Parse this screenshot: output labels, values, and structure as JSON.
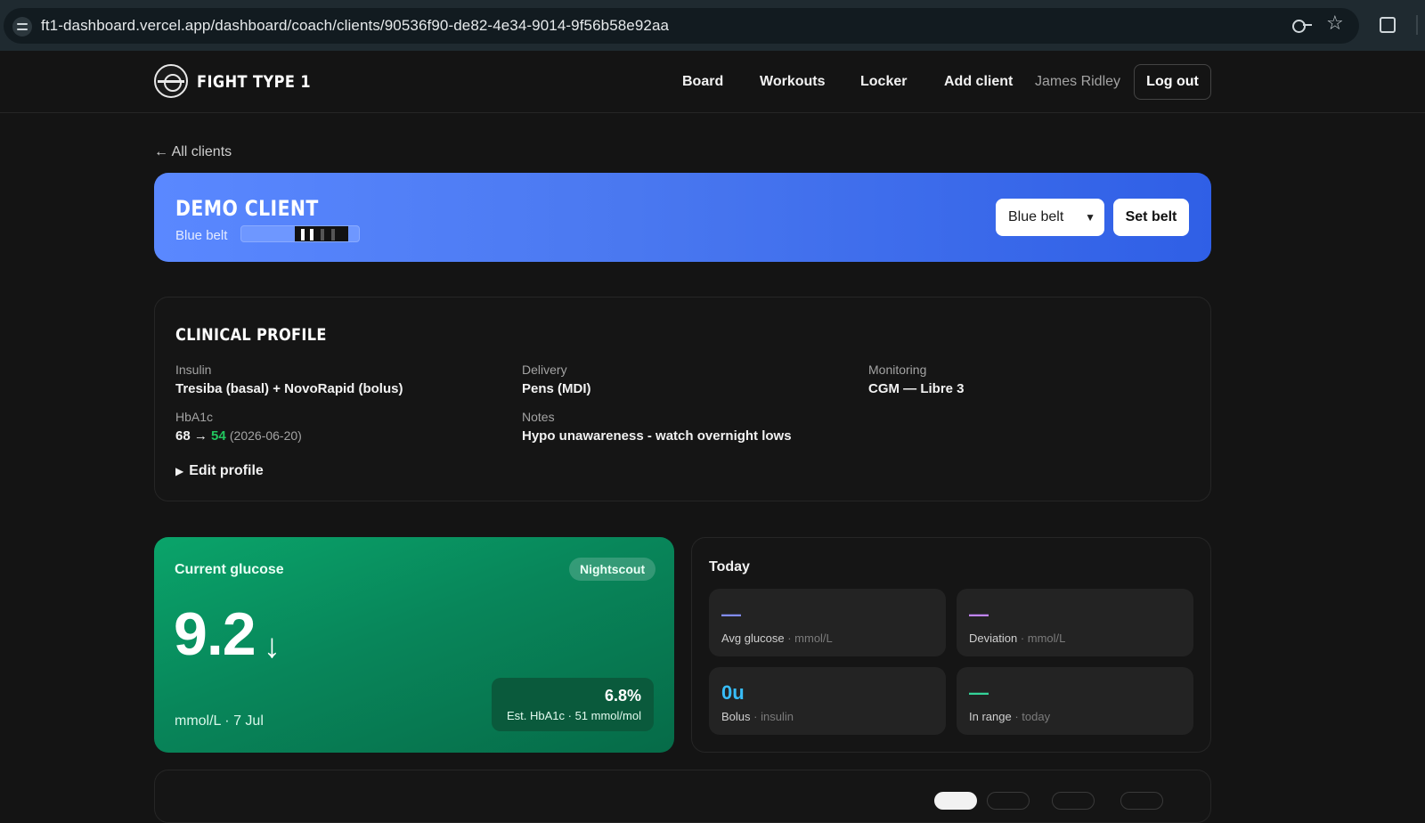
{
  "browser": {
    "url": "ft1-dashboard.vercel.app/dashboard/coach/clients/90536f90-de82-4e34-9014-9f56b58e92aa"
  },
  "header": {
    "brand": "FIGHT TYPE 1",
    "nav": [
      "Board",
      "Workouts",
      "Locker",
      "Add client"
    ],
    "user_name": "James Ridley",
    "logout_label": "Log out"
  },
  "back_link": "← All clients",
  "client": {
    "name": "DEMO CLIENT",
    "belt": "Blue belt",
    "belt_select_value": "Blue belt",
    "set_belt_label": "Set belt",
    "belt_color": "#4a78f0"
  },
  "clinical": {
    "title": "CLINICAL PROFILE",
    "insulin_label": "Insulin",
    "insulin_value": "Tresiba (basal) + NovoRapid (bolus)",
    "delivery_label": "Delivery",
    "delivery_value": "Pens (MDI)",
    "monitoring_label": "Monitoring",
    "monitoring_value": "CGM — Libre 3",
    "hba1c_label": "HbA1c",
    "hba1c_from": "68",
    "hba1c_arrow": "→",
    "hba1c_to": "54",
    "hba1c_date": "(2026-06-20)",
    "notes_label": "Notes",
    "notes_value": "Hypo unawareness - watch overnight lows",
    "edit_label": "Edit profile"
  },
  "glucose": {
    "title": "Current glucose",
    "source_badge": "Nightscout",
    "value": "9.2",
    "trend": "↓",
    "unit_line": "mmol/L · 7 Jul",
    "est_hba1c": "6.8%",
    "est_hba1c_sub": "Est. HbA1c · 51 mmol/mol",
    "card_color": "#08865a"
  },
  "today": {
    "title": "Today",
    "stats": [
      {
        "value": "—",
        "label": "Avg glucose",
        "sub": "mmol/L",
        "color": "#818cf8"
      },
      {
        "value": "—",
        "label": "Deviation",
        "sub": "mmol/L",
        "color": "#c084fc"
      },
      {
        "value": "0u",
        "label": "Bolus",
        "sub": "insulin",
        "color": "#38bdf8"
      },
      {
        "value": "—",
        "label": "In range",
        "sub": "today",
        "color": "#34d399"
      }
    ]
  }
}
